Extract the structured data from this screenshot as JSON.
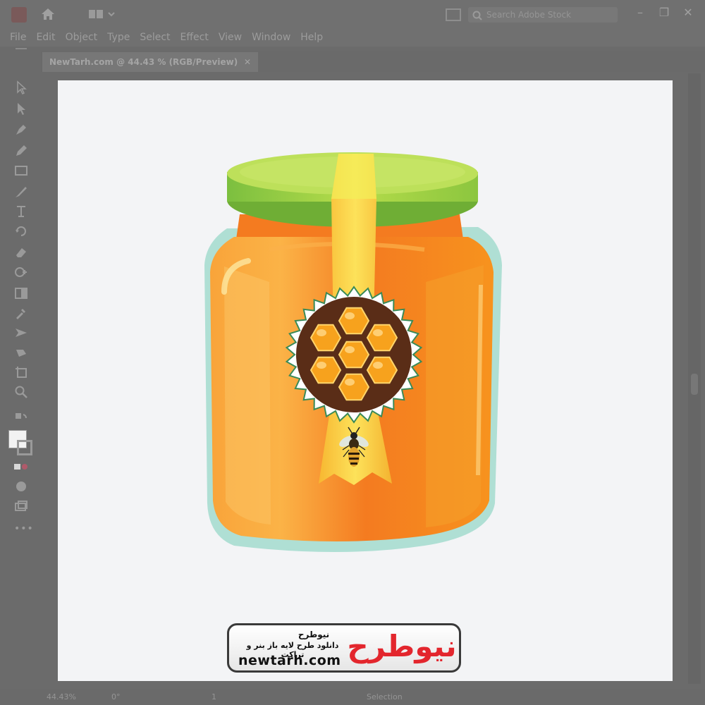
{
  "app": {
    "menu": [
      "File",
      "Edit",
      "Object",
      "Type",
      "Select",
      "Effect",
      "View",
      "Window",
      "Help"
    ],
    "search_placeholder": "Search Adobe Stock",
    "window_controls": {
      "minimize": "–",
      "restore": "❐",
      "close": "✕"
    }
  },
  "document": {
    "tab_label": "NewTarh.com @ 44.43 % (RGB/Preview)",
    "tab_close": "✕"
  },
  "status": {
    "zoom": "44.43%",
    "rotation": "0°",
    "artboard_number": "1",
    "tool_name": "Selection"
  },
  "watermark": {
    "title_fa": "نیوطرح",
    "subtitle_fa": "دانلود طرح لایه باز بنر و تراکت",
    "url": "newtarh.com",
    "mark_fa": "نیوطرح"
  },
  "colors": {
    "lid": "#8cc63f",
    "honey": "#f7941d",
    "seal": "#5a2d17",
    "ribbon": "#fbc02d",
    "glass": "#9ed8c8",
    "brand_red": "#e3262d"
  },
  "icons": [
    "home-icon",
    "workspace-icon",
    "search-icon",
    "selection-tool-icon",
    "direct-selection-tool-icon",
    "pen-tool-icon",
    "pencil-tool-icon",
    "rectangle-tool-icon",
    "brush-tool-icon",
    "type-tool-icon",
    "rotate-tool-icon",
    "eraser-tool-icon",
    "shape-builder-icon",
    "gradient-tool-icon",
    "eyedropper-tool-icon",
    "blend-tool-icon",
    "symbol-sprayer-icon",
    "artboard-tool-icon",
    "zoom-tool-icon",
    "swap-colors-icon",
    "fill-color-icon",
    "stroke-color-icon",
    "draw-mode-icon",
    "screen-mode-icon",
    "more-tools-icon",
    "honey-jar-illustration",
    "bee-icon",
    "honeycomb-icon"
  ]
}
